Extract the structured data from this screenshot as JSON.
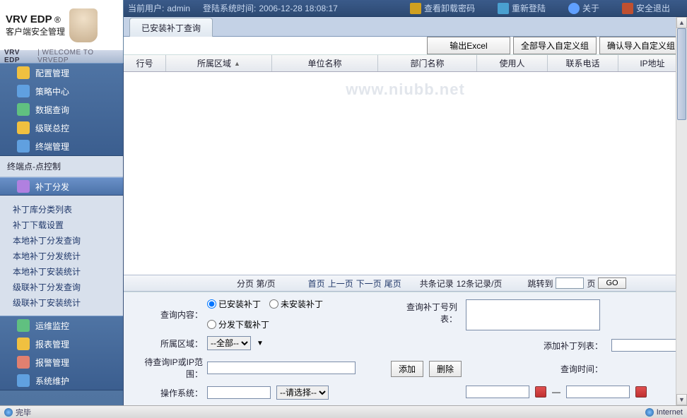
{
  "header": {
    "current_user_label": "当前用户:",
    "current_user": "admin",
    "login_time_label": "登陆系统时间:",
    "login_time": "2006-12-28 18:08:17",
    "view_uninstall_pwd": "查看卸载密码",
    "relogin": "重新登陆",
    "about": "关于",
    "safe_exit": "安全退出"
  },
  "brand": {
    "product": "VRV EDP",
    "reg": "®",
    "tagline": "客户端安全管理",
    "welcome": "WELCOME TO VRVEDP"
  },
  "sidebar": {
    "main": [
      {
        "label": "配置管理"
      },
      {
        "label": "策略中心"
      },
      {
        "label": "数据查询"
      },
      {
        "label": "级联总控"
      },
      {
        "label": "终端管理"
      }
    ],
    "section_title": "终端点-点控制",
    "section_highlight": "补丁分发",
    "sub_links": [
      "补丁库分类列表",
      "补丁下载设置",
      "本地补丁分发查询",
      "本地补丁分发统计",
      "本地补丁安装统计",
      "级联补丁分发查询",
      "级联补丁安装统计"
    ],
    "bottom": [
      {
        "label": "运维监控"
      },
      {
        "label": "报表管理"
      },
      {
        "label": "报警管理"
      },
      {
        "label": "系统维护"
      }
    ]
  },
  "content": {
    "tab": "已安装补丁查询",
    "toolbar": {
      "export_excel": "输出Excel",
      "import_group": "全部导入自定义组",
      "confirm_group": "确认导入自定义组"
    },
    "columns": {
      "c1": "行号",
      "c2": "所属区域",
      "c3": "单位名称",
      "c4": "部门名称",
      "c5": "使用人",
      "c6": "联系电话",
      "c7": "IP地址"
    },
    "watermark": "www.niubb.net",
    "pager": {
      "page_info": "分页 第/页",
      "first": "首页",
      "prev": "上一页",
      "next": "下一页",
      "last": "尾页",
      "total": "共条记录",
      "per_page": "12条记录/页",
      "jump_to": "跳转到",
      "page_suffix": "页",
      "go": "GO",
      "page_value": ""
    },
    "form": {
      "query_content_label": "查询内容：",
      "opt_installed": "已安装补丁",
      "opt_not_installed": "未安装补丁",
      "opt_distributed": "分发下载补丁",
      "area_label": "所属区域：",
      "area_value": "--全部--",
      "ip_range_label": "待查询IP或IP范围：",
      "ip_range_value": "",
      "os_label": "操作系统：",
      "os_value": "",
      "os_select": "--请选择--",
      "query_patch_list_label": "查询补丁号列表：",
      "query_patch_list_value": "",
      "add_patch_list_label": "添加补丁列表：",
      "add_patch_value": "",
      "add_btn": "添加",
      "del_btn": "删除",
      "query_time_label": "查询时间：",
      "time_from": "",
      "time_to": "",
      "dash": "—"
    }
  },
  "status": {
    "done": "完毕",
    "zone": "Internet"
  }
}
